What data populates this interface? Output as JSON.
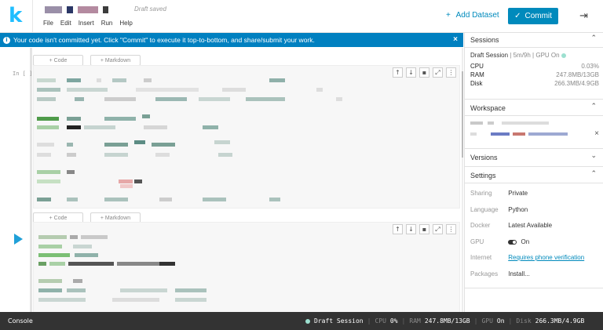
{
  "app": {
    "logo": "k",
    "draft_status": "Draft saved"
  },
  "menu": {
    "items": [
      "File",
      "Edit",
      "Insert",
      "Run",
      "Help"
    ]
  },
  "toolbar": {
    "add_dataset_label": "Add Dataset",
    "commit_label": "Commit"
  },
  "banner": {
    "text": "Your code isn't committed yet. Click \"Commit\" to execute it top-to-bottom, and share/submit your work."
  },
  "cells": {
    "add_code_label": "+ Code",
    "add_markdown_label": "+ Markdown",
    "prompt": "In [ ]:"
  },
  "sessions": {
    "title": "Sessions",
    "status": "Draft Session",
    "duration": "5m/9h",
    "gpu": "GPU On",
    "cpu_label": "CPU",
    "cpu_value": "0.03%",
    "ram_label": "RAM",
    "ram_value": "247.8MB/13GB",
    "disk_label": "Disk",
    "disk_value": "266.3MB/4.9GB"
  },
  "workspace": {
    "title": "Workspace"
  },
  "versions": {
    "title": "Versions"
  },
  "settings": {
    "title": "Settings",
    "rows": [
      {
        "key": "Sharing",
        "value": "Private"
      },
      {
        "key": "Language",
        "value": "Python"
      },
      {
        "key": "Docker",
        "value": "Latest Available"
      },
      {
        "key": "GPU",
        "value": "On"
      },
      {
        "key": "Internet",
        "value": "Requires phone verification"
      },
      {
        "key": "Packages",
        "value": "Install..."
      }
    ]
  },
  "statusbar": {
    "console_label": "Console",
    "session": "Draft Session",
    "cpu_label": "CPU",
    "cpu_value": "0%",
    "ram_label": "RAM",
    "ram_value": "247.8MB/13GB",
    "gpu_label": "GPU",
    "gpu_value": "On",
    "disk_label": "Disk",
    "disk_value": "266.3MB/4.9GB"
  },
  "colors": {
    "accent": "#20beff",
    "primary": "#008abc",
    "banner": "#0080c0",
    "statusbar": "#333333"
  },
  "icons": {
    "close": "×",
    "collapse": "⇥",
    "chevron_up": "⌃",
    "chevron_down": "⌄",
    "move_up": "↑",
    "move_down": "↓",
    "delete": "🗑",
    "expand": "⤢",
    "more": "⋮"
  }
}
